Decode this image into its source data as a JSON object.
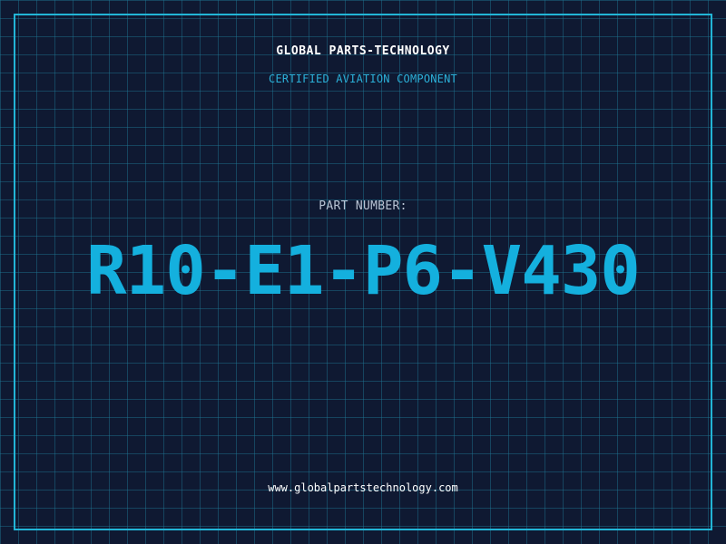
{
  "header": {
    "company": "GLOBAL PARTS-TECHNOLOGY",
    "subtitle": "CERTIFIED AVIATION COMPONENT"
  },
  "part": {
    "label": "PART NUMBER:",
    "number": "R10-E1-P6-V430"
  },
  "footer": {
    "url": "www.globalpartstechnology.com"
  },
  "colors": {
    "background": "#0f1932",
    "grid": "#1e7896",
    "frame": "#22b5d6",
    "accent": "#14b0de",
    "text": "#ffffff",
    "muted": "#b9c4d4"
  }
}
